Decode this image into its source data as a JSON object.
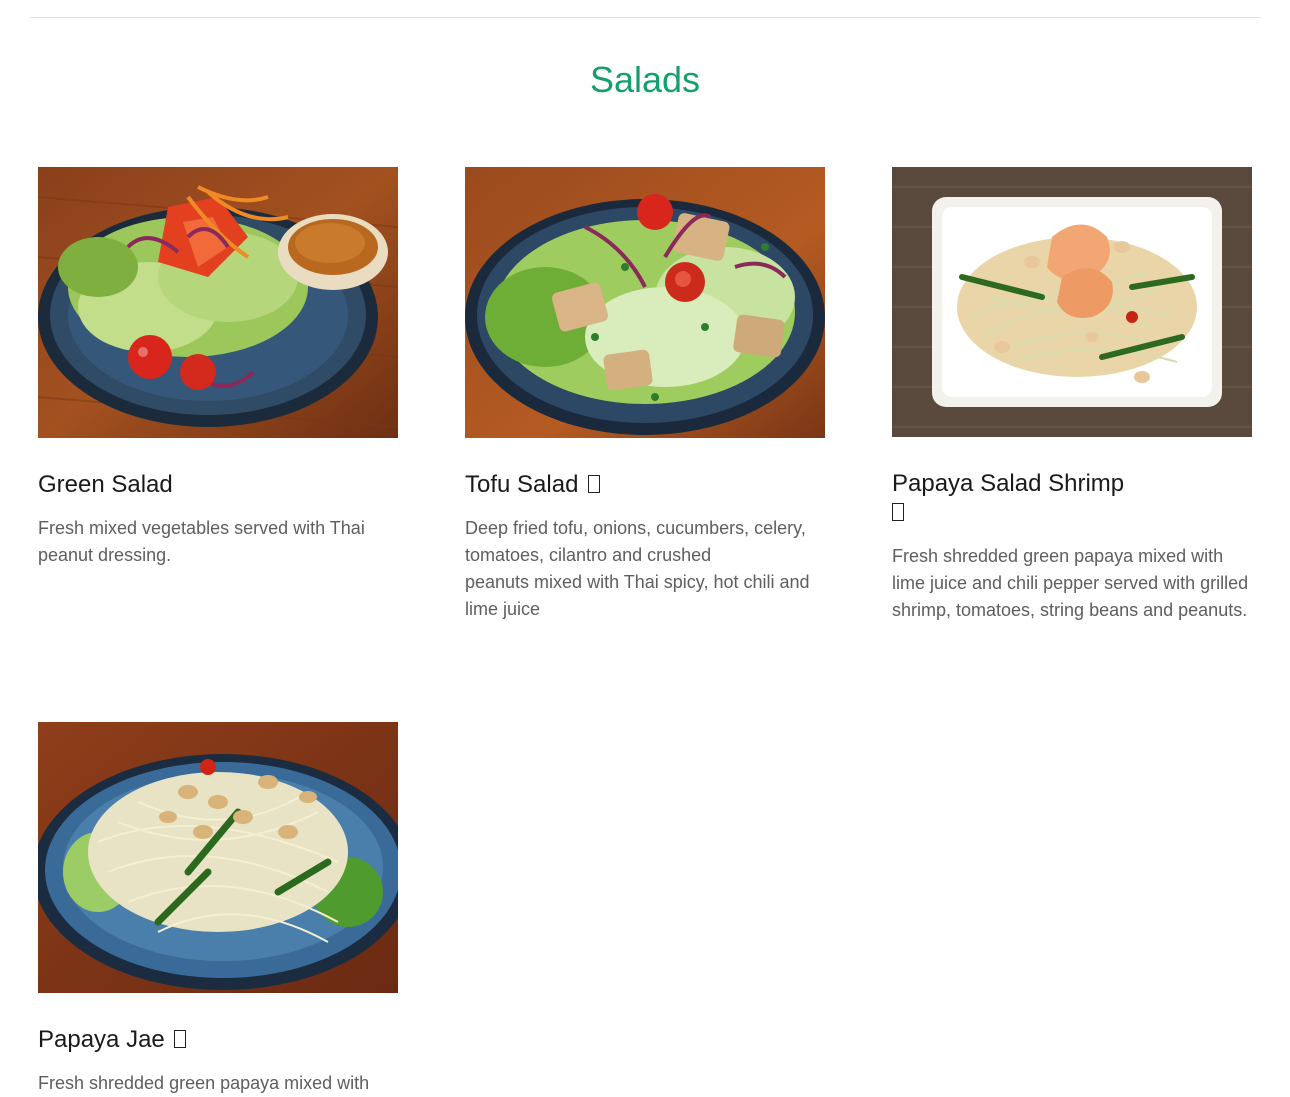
{
  "section": {
    "title": "Salads"
  },
  "items": [
    {
      "name": "Green Salad",
      "description": "Fresh mixed vegetables served with Thai peanut dressing.",
      "image_alt": "Green Salad",
      "badge_icon": "leaf-icon"
    },
    {
      "name": "Tofu Salad",
      "description_lines": [
        "Deep fried tofu, onions, cucumbers, celery,",
        "tomatoes, cilantro and crushed",
        "peanuts mixed with Thai spicy, hot chili and",
        "lime juice"
      ],
      "image_alt": "Tofu Salad",
      "badge_icon": "leaf-icon"
    },
    {
      "name": "Papaya Salad Shrimp",
      "description": "Fresh shredded green papaya mixed with lime juice and chili pepper served with grilled shrimp, tomatoes, string beans and peanuts.",
      "image_alt": "Papaya Salad Shrimp",
      "badge_icon": "leaf-icon"
    },
    {
      "name": "Papaya Jae",
      "description": "Fresh shredded green papaya mixed with",
      "image_alt": "Papaya Jae",
      "badge_icon": "leaf-icon"
    }
  ],
  "colors": {
    "title": "#14a06a",
    "name": "#1a1a1a",
    "description": "#5e5e5e",
    "divider": "#e2e2e2"
  }
}
